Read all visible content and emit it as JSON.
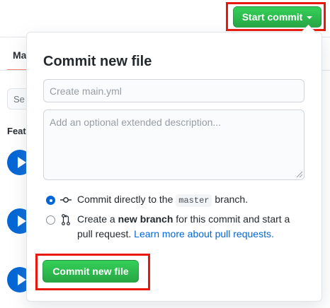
{
  "background": {
    "tab_label": "Ma",
    "search_placeholder": "Se",
    "featured_label": "Feat"
  },
  "start_commit": {
    "label": "Start commit",
    "caret_icon": "triangle-down-icon",
    "color": "#28a745"
  },
  "commit_panel": {
    "title": "Commit new file",
    "filename_placeholder": "Create main.yml",
    "filename_value": "",
    "description_placeholder": "Add an optional extended description...",
    "description_value": "",
    "options": [
      {
        "selected": true,
        "icon": "git-commit-icon",
        "text_before": "Commit directly to the",
        "branch_code": "master",
        "text_after": "branch."
      },
      {
        "selected": false,
        "icon": "git-pull-request-icon",
        "text_before": "Create a",
        "bold_text": "new branch",
        "text_after": "for this commit and start a",
        "line2_text": "pull request.",
        "link_text": "Learn more about pull requests."
      }
    ],
    "submit_label": "Commit new file"
  },
  "colors": {
    "highlight": "#e8190c",
    "primary_green": "#28a745",
    "link_blue": "#0366d6"
  }
}
